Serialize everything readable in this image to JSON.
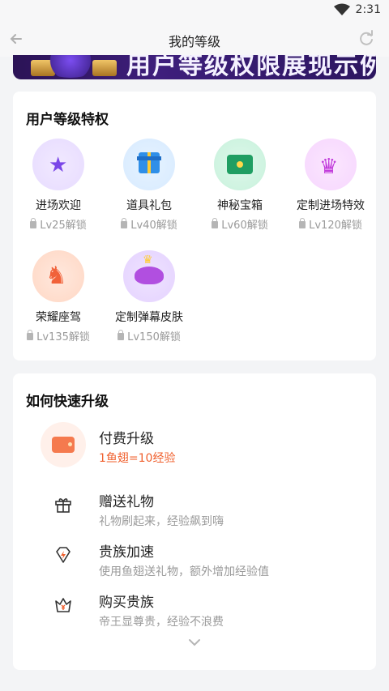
{
  "status_bar": {
    "time": "2:31"
  },
  "nav": {
    "title": "我的等级"
  },
  "banner": {
    "text": "用户等级权限展现示例"
  },
  "privileges": {
    "title": "用户等级特权",
    "items": [
      {
        "name": "进场欢迎",
        "unlock": "Lv25解锁",
        "icon": "star-icon"
      },
      {
        "name": "道具礼包",
        "unlock": "Lv40解锁",
        "icon": "gift-box-icon"
      },
      {
        "name": "神秘宝箱",
        "unlock": "Lv60解锁",
        "icon": "treasure-chest-icon"
      },
      {
        "name": "定制进场特效",
        "unlock": "Lv120解锁",
        "icon": "crown-icon"
      },
      {
        "name": "荣耀座驾",
        "unlock": "Lv135解锁",
        "icon": "horse-icon"
      },
      {
        "name": "定制弹幕皮肤",
        "unlock": "Lv150解锁",
        "icon": "winged-crown-icon"
      }
    ]
  },
  "upgrade": {
    "title": "如何快速升级",
    "pay": {
      "title": "付费升级",
      "sub": "1鱼翅=10经验"
    },
    "methods": [
      {
        "title": "赠送礼物",
        "sub": "礼物刷起来，经验飙到嗨",
        "icon": "gift-icon"
      },
      {
        "title": "贵族加速",
        "sub": "使用鱼翅送礼物，额外增加经验值",
        "icon": "lightning-diamond-icon"
      },
      {
        "title": "购买贵族",
        "sub": "帝王显尊贵，经验不浪费",
        "icon": "crown-yen-icon"
      }
    ]
  },
  "colors": {
    "accent": "#f0602e",
    "background": "#f3f4f6"
  }
}
